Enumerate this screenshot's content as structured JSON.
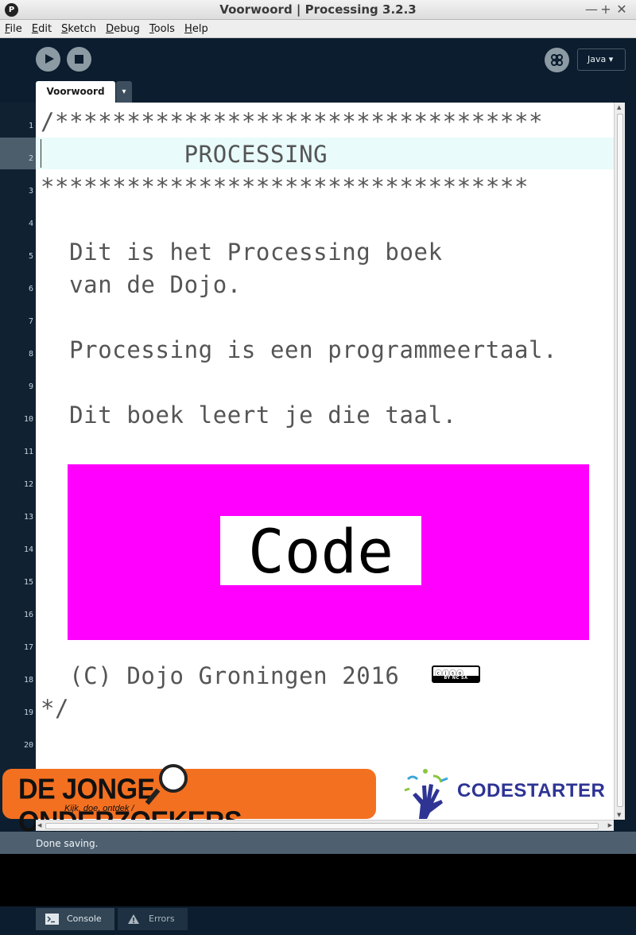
{
  "window": {
    "title": "Voorwoord | Processing 3.2.3",
    "controls": [
      "—",
      "+",
      "✕"
    ]
  },
  "menu": [
    "File",
    "Edit",
    "Sketch",
    "Debug",
    "Tools",
    "Help"
  ],
  "toolbar": {
    "mode": "Java ▾"
  },
  "tabs": {
    "active": "Voorwoord",
    "menu_arrow": "▾"
  },
  "editor": {
    "line_numbers": [
      "1",
      "2",
      "3",
      "4",
      "5",
      "6",
      "7",
      "8",
      "9",
      "10",
      "11",
      "12",
      "13",
      "14",
      "15",
      "16",
      "17",
      "18",
      "19",
      "20"
    ],
    "current_line": 2,
    "lines": [
      "/**********************************",
      "          PROCESSING",
      "**********************************",
      "",
      "  Dit is het Processing boek",
      "  van de Dojo.",
      "",
      "  Processing is een programmeertaal.",
      "",
      "  Dit boek leert je die taal.",
      "",
      "",
      "",
      "",
      "",
      "",
      "",
      "  (C) Dojo Groningen 2016",
      "*/",
      ""
    ],
    "image_label": "Code",
    "license_badge": {
      "top": "🅭🅯$🄎",
      "bottom": "BY NC SA"
    }
  },
  "logos": {
    "dju_name": "DE JONGE ONDERZOEKERS",
    "dju_slogan": "Kijk, doe, ontdek /",
    "codestarter": "CODESTARTER"
  },
  "status": {
    "message": "Done saving."
  },
  "footer": {
    "console": "Console",
    "errors": "Errors"
  },
  "colors": {
    "accent_magenta": "#ff00ff",
    "bg_dark": "#0b1d2e",
    "dju_orange": "#f37021",
    "codestarter_blue": "#2e3494"
  }
}
